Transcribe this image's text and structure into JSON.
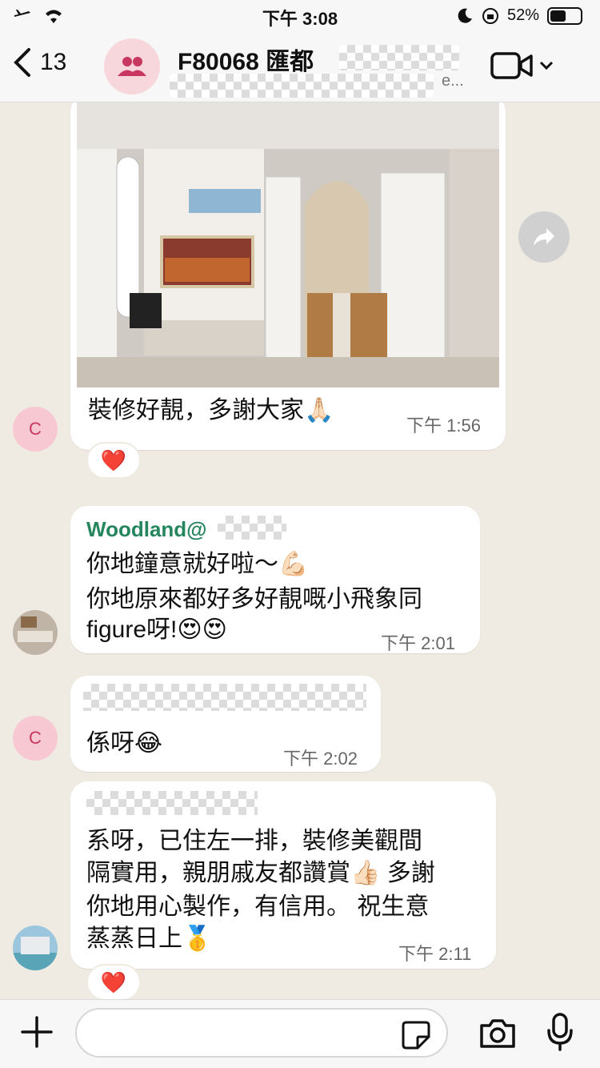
{
  "status": {
    "time": "下午 3:08",
    "battery": "52%",
    "battery_level": 0.52
  },
  "header": {
    "back_count": "13",
    "title": "F80068 匯都",
    "subtitle_suffix": "e..."
  },
  "messages": [
    {
      "id": "m1",
      "text": "裝修好靚，多謝大家🙏🏻",
      "time": "下午 1:56",
      "reaction": "❤️"
    },
    {
      "id": "m2",
      "sender": "Woodland@",
      "text_lines": [
        "你地鐘意就好啦～💪🏻",
        "你地原來都好多好靚嘅小飛象同",
        "figure呀!😍😍"
      ],
      "time": "下午 2:01"
    },
    {
      "id": "m3",
      "text": "係呀😂",
      "time": "下午 2:02"
    },
    {
      "id": "m4",
      "text_lines": [
        "系呀，已住左一排，裝修美觀間",
        "隔實用，親朋戚友都讚賞👍🏻 多謝",
        "你地用心製作，有信用。 祝生意",
        "蒸蒸日上🥇"
      ],
      "time": "下午 2:11",
      "reaction": "❤️"
    }
  ],
  "avatars": {
    "c_letter": "C"
  },
  "icons": {
    "back": "chevron-left-icon",
    "group": "group-icon",
    "video": "video-call-icon",
    "forward": "forward-icon",
    "plus": "plus-icon",
    "sticker": "sticker-icon",
    "camera": "camera-icon",
    "mic": "microphone-icon"
  },
  "colors": {
    "sender": "#25865e",
    "avatar_bg": "#f7c8d1",
    "avatar_fg": "#c8385e",
    "chat_bg": "#efeae2"
  }
}
